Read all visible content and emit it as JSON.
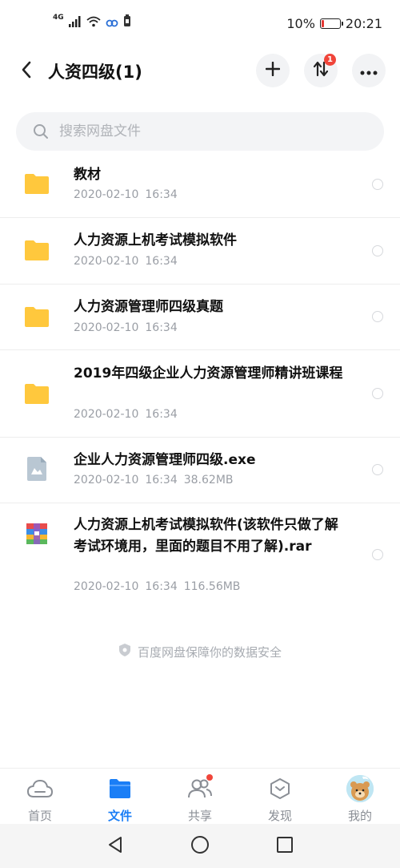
{
  "status_bar": {
    "network": "4G",
    "battery": "10%",
    "time": "20:21",
    "battery_color": "#e53935"
  },
  "header": {
    "title": "人资四级(1)",
    "back_icon": "chevron-left-icon",
    "plus_icon": "plus-icon",
    "sort_icon": "transfer-icon",
    "sort_badge": "1",
    "more_icon": "more-horizontal-icon"
  },
  "search": {
    "placeholder": "搜索网盘文件",
    "icon": "search-icon"
  },
  "files": [
    {
      "name": "教材",
      "date": "2020-02-10",
      "time": "16:34",
      "size": "",
      "type": "folder"
    },
    {
      "name": "人力资源上机考试模拟软件",
      "date": "2020-02-10",
      "time": "16:34",
      "size": "",
      "type": "folder"
    },
    {
      "name": "人力资源管理师四级真题",
      "date": "2020-02-10",
      "time": "16:34",
      "size": "",
      "type": "folder"
    },
    {
      "name": "2019年四级企业人力资源管理师精讲班课程",
      "date": "2020-02-10",
      "time": "16:34",
      "size": "",
      "type": "folder"
    },
    {
      "name": "企业人力资源管理师四级.exe",
      "date": "2020-02-10",
      "time": "16:34",
      "size": "38.62MB",
      "type": "exe"
    },
    {
      "name": "人力资源上机考试模拟软件(该软件只做了解考试环境用，里面的题目不用了解).rar",
      "date": "2020-02-10",
      "time": "16:34",
      "size": "116.56MB",
      "type": "rar"
    }
  ],
  "footer_note": "百度网盘保障你的数据安全",
  "tabs": [
    {
      "label": "首页",
      "icon": "cloud-icon",
      "active": false
    },
    {
      "label": "文件",
      "icon": "folder-icon",
      "active": true
    },
    {
      "label": "共享",
      "icon": "people-icon",
      "active": false
    },
    {
      "label": "发现",
      "icon": "compass-icon",
      "active": false
    },
    {
      "label": "我的",
      "icon": "avatar-icon",
      "active": false
    }
  ],
  "colors": {
    "accent": "#1a7ef6",
    "folder": "#ffc83d",
    "badge": "#f0453a"
  }
}
